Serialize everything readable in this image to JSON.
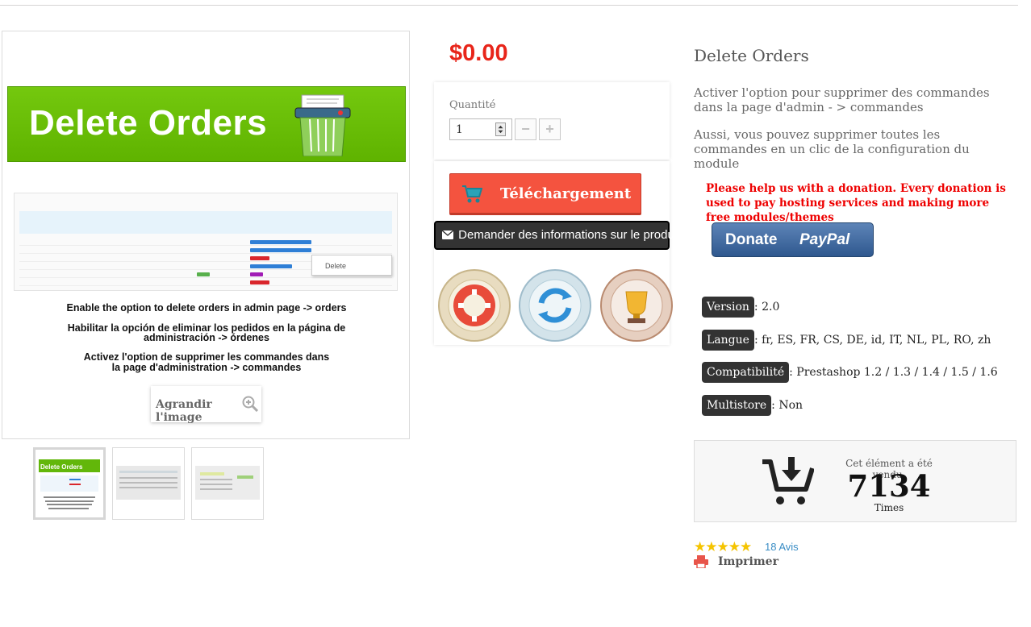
{
  "image": {
    "banner_title": "Delete Orders",
    "context_menu_item": "Delete",
    "caption_en": "Enable the option to delete orders in admin page -> orders",
    "caption_es_1": "Habilitar la opción de eliminar los pedidos en la página de",
    "caption_es_2": "administración -> órdenes",
    "caption_fr_1": "Activez l'option de supprimer les commandes dans",
    "caption_fr_2": "la page d'administration -> commandes",
    "enlarge_label": "Agrandir l'image",
    "thumbnail_title": "Delete Orders"
  },
  "buy": {
    "price": "$0.00",
    "quantity_label": "Quantité",
    "quantity_value": "1",
    "minus": "−",
    "plus": "+",
    "download_label": "Téléchargement",
    "info_label": "Demander des informations sur le produit",
    "badges": [
      "free-support",
      "free-updates",
      "best-ratings"
    ]
  },
  "product": {
    "title": "Delete Orders",
    "desc1": "Activer l'option pour supprimer des commandes dans la page d'admin - > commandes",
    "desc2": "Aussi, vous pouvez supprimer toutes les commandes en un clic de la configuration du module",
    "donation_text": "Please help us with a donation. Every donation is used to pay hosting services and making more free modules/themes",
    "donate_word": "Donate",
    "paypal_word": "PayPal",
    "specs": [
      {
        "label": "Version",
        "value": ": 2.0"
      },
      {
        "label": "Langue",
        "value": ": fr, ES, FR, CS, DE, id, IT, NL, PL, RO, zh"
      },
      {
        "label": "Compatibilité",
        "value": ": Prestashop 1.2 / 1.3 / 1.4 / 1.5 / 1.6"
      },
      {
        "label": "Multistore",
        "value": ": Non"
      }
    ],
    "sold_caption": "Cet élément a été vendu.",
    "sold_count": "7134",
    "sold_times": "Times",
    "rating_stars": 5,
    "stars": "★★★★★",
    "reviews": "18 Avis",
    "print": "Imprimer"
  },
  "colors": {
    "price": "#e8251a",
    "download": "#f4533f",
    "reviews_link": "#3a8dc5",
    "donation": "#ee0000"
  }
}
